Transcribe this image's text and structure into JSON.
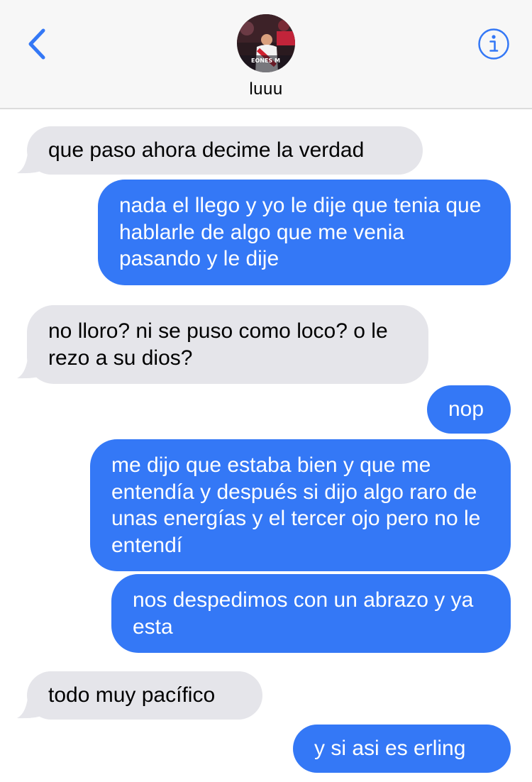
{
  "header": {
    "contact_name": "luuu",
    "avatar_caption": "EONES M",
    "back_icon": "chevron-left-icon",
    "info_icon": "info-circle-icon",
    "accent_color": "#3478f6"
  },
  "messages": [
    {
      "direction": "incoming",
      "text": "que paso ahora decime la verdad"
    },
    {
      "direction": "outgoing",
      "text": "nada el llego y yo le dije que tenia que hablarle de algo que me venia pasando y le dije"
    },
    {
      "direction": "incoming",
      "text": "no lloro? ni se puso como loco? o le rezo a su dios?"
    },
    {
      "direction": "outgoing",
      "text": "nop"
    },
    {
      "direction": "outgoing",
      "text": "me dijo que estaba bien y que me entendía y después si dijo algo raro de unas energías y el tercer ojo pero no le entendí"
    },
    {
      "direction": "outgoing",
      "text": "nos despedimos con un abrazo y ya esta"
    },
    {
      "direction": "incoming",
      "text": "todo muy pacífico"
    },
    {
      "direction": "outgoing",
      "text": "y si asi es erling"
    }
  ],
  "colors": {
    "incoming_bubble": "#e5e5ea",
    "outgoing_bubble": "#3478f6"
  }
}
